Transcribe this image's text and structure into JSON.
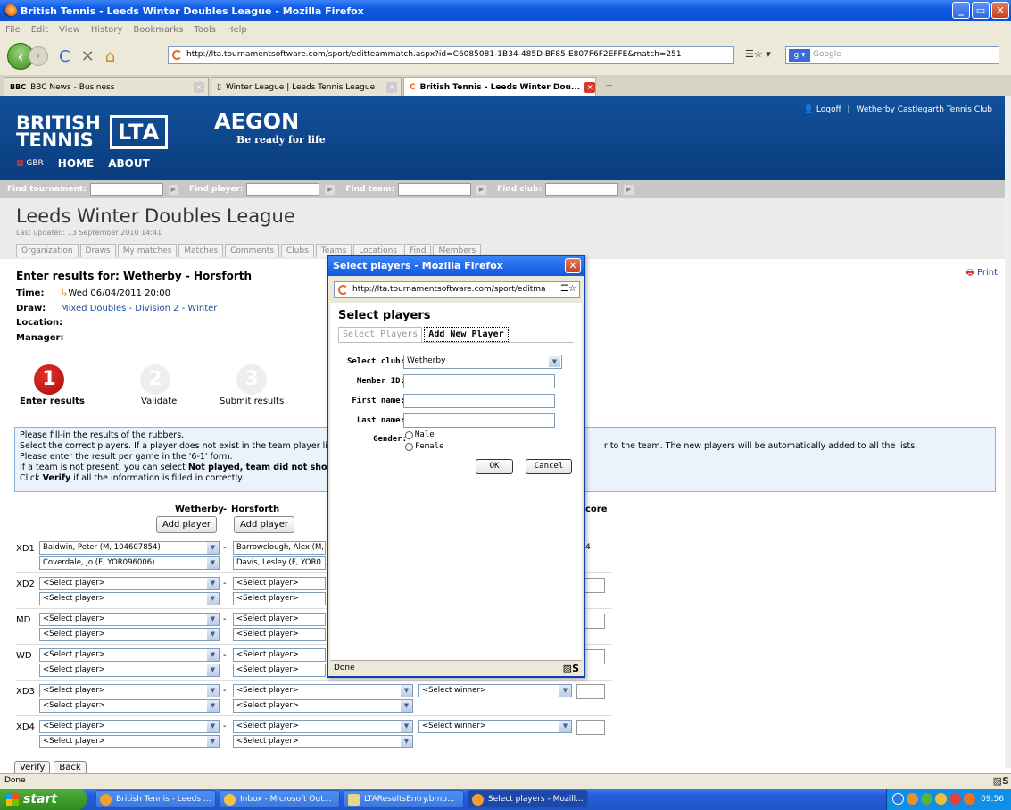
{
  "window": {
    "title": "British Tennis - Leeds Winter Doubles League - Mozilla Firefox"
  },
  "menu": [
    "File",
    "Edit",
    "View",
    "History",
    "Bookmarks",
    "Tools",
    "Help"
  ],
  "browser": {
    "url": "http://lta.tournamentsoftware.com/sport/editteammatch.aspx?id=C6085081-1B34-485D-BF85-E807F6F2EFFE&match=251",
    "search_placeholder": "Google"
  },
  "tabs": [
    {
      "label": "BBC News - Business"
    },
    {
      "label": "Winter League | Leeds Tennis League"
    },
    {
      "label": "British Tennis - Leeds Winter Dou..."
    }
  ],
  "header": {
    "british": "BRITISH",
    "tennis": "TENNIS",
    "lta": "LTA",
    "aegon": "AEGON",
    "tagline": "Be ready for life",
    "logoff": "Logoff",
    "club": "Wetherby Castlegarth Tennis Club",
    "gbr": "GBR",
    "nav_home": "HOME",
    "nav_about": "ABOUT"
  },
  "findbar": {
    "tournament": "Find tournament:",
    "player": "Find player:",
    "team": "Find team:",
    "club": "Find club:"
  },
  "league": {
    "title": "Leeds Winter Doubles League",
    "last_updated": "Last updated: 13 September 2010 14:41",
    "tabs": [
      "Organization",
      "Draws",
      "My matches",
      "Matches",
      "Comments",
      "Clubs",
      "Teams",
      "Locations",
      "Find",
      "Members"
    ]
  },
  "match": {
    "heading": "Enter results for: Wetherby - Horsforth",
    "print": "Print",
    "time_label": "Time:",
    "time_value": "Wed 06/04/2011 20:00",
    "draw_label": "Draw:",
    "draw_value": "Mixed Doubles - Division 2 - Winter",
    "location_label": "Location:",
    "manager_label": "Manager:"
  },
  "steps": [
    {
      "num": "1",
      "label": "Enter results"
    },
    {
      "num": "2",
      "label": "Validate"
    },
    {
      "num": "3",
      "label": "Submit results"
    }
  ],
  "instructions": {
    "l1": "Please fill-in the results of the rubbers.",
    "l2a": "Select the correct players. If a player does not exist in the team player lis",
    "l2b": "r to the team. The new players will be automatically added to all the lists.",
    "l3": "Please enter the result per game in the '6-1' form.",
    "l4a": "If a team is not present, you can select ",
    "l4b": "Not played, team did not show u",
    "l5a": "Click ",
    "l5b": "Verify",
    "l5c": " if all the information is filled in correctly."
  },
  "team_header": {
    "home": "Wetherby",
    "sep": "-",
    "away": "Horsforth",
    "score": "core",
    "add_player": "Add player"
  },
  "rubbers": [
    {
      "label": "XD1",
      "h1": "Baldwin, Peter (M, 104607854)",
      "h2": "Coverdale, Jo (F, YOR096006)",
      "a1": "Barrowclough, Alex (M,",
      "a2": "Davis, Lesley (F, YOR0",
      "score": "4"
    },
    {
      "label": "XD2",
      "h1": "<Select player>",
      "h2": "<Select player>",
      "a1": "<Select player>",
      "a2": "<Select player>",
      "score": ""
    },
    {
      "label": "MD",
      "h1": "<Select player>",
      "h2": "<Select player>",
      "a1": "<Select player>",
      "a2": "<Select player>",
      "score": ""
    },
    {
      "label": "WD",
      "h1": "<Select player>",
      "h2": "<Select player>",
      "a1": "<Select player>",
      "a2": "<Select player>",
      "score": ""
    },
    {
      "label": "XD3",
      "h1": "<Select player>",
      "h2": "<Select player>",
      "a1": "<Select player>",
      "a2": "<Select player>",
      "winner": "<Select winner>",
      "score": ""
    },
    {
      "label": "XD4",
      "h1": "<Select player>",
      "h2": "<Select player>",
      "a1": "<Select player>",
      "a2": "<Select player>",
      "winner": "<Select winner>",
      "score": ""
    }
  ],
  "buttons": {
    "verify": "Verify",
    "back": "Back"
  },
  "status": {
    "text": "Done"
  },
  "popup": {
    "title": "Select players - Mozilla Firefox",
    "url": "http://lta.tournamentsoftware.com/sport/editma",
    "heading": "Select players",
    "tab1": "Select Players",
    "tab2": "Add New Player",
    "club_label": "Select club:",
    "club_value": "Wetherby",
    "member_label": "Member ID:",
    "first_label": "First name:",
    "last_label": "Last name:",
    "gender_label": "Gender:",
    "male": "Male",
    "female": "Female",
    "ok": "OK",
    "cancel": "Cancel",
    "status": "Done"
  },
  "taskbar": {
    "start": "start",
    "items": [
      "British Tennis - Leeds ...",
      "Inbox - Microsoft Out...",
      "LTAResultsEntry.bmp...",
      "Select players - Mozill..."
    ],
    "clock": "09:56"
  }
}
